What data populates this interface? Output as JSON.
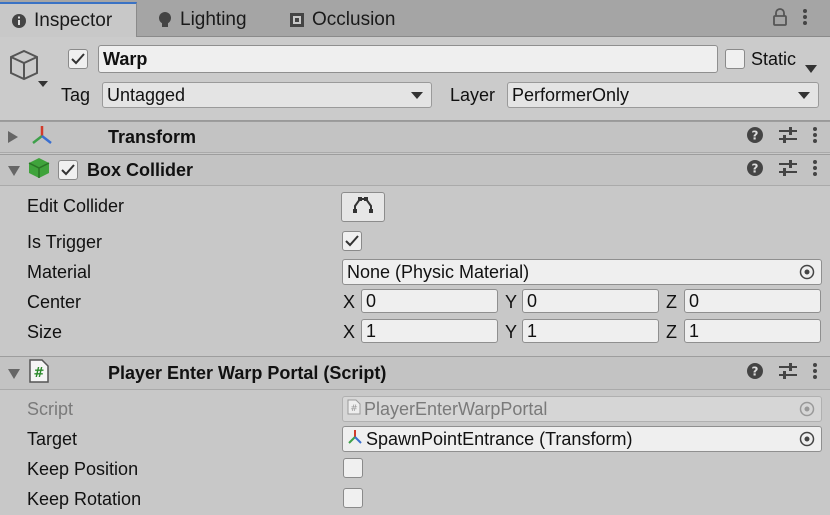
{
  "tabs": [
    {
      "label": "Inspector",
      "active": true
    },
    {
      "label": "Lighting",
      "active": false
    },
    {
      "label": "Occlusion",
      "active": false
    }
  ],
  "object": {
    "active_checked": true,
    "name": "Warp",
    "static_label": "Static",
    "static_checked": false,
    "tag_label": "Tag",
    "tag_value": "Untagged",
    "layer_label": "Layer",
    "layer_value": "PerformerOnly"
  },
  "transform": {
    "title": "Transform",
    "expanded": false
  },
  "box_collider": {
    "title": "Box Collider",
    "enabled": true,
    "expanded": true,
    "edit_collider_label": "Edit Collider",
    "is_trigger_label": "Is Trigger",
    "is_trigger_checked": true,
    "material_label": "Material",
    "material_value": "None (Physic Material)",
    "center_label": "Center",
    "center": {
      "x": "0",
      "y": "0",
      "z": "0"
    },
    "size_label": "Size",
    "size": {
      "x": "1",
      "y": "1",
      "z": "1"
    },
    "axis": {
      "x": "X",
      "y": "Y",
      "z": "Z"
    }
  },
  "script_comp": {
    "title": "Player Enter Warp Portal (Script)",
    "expanded": true,
    "script_label": "Script",
    "script_value": "PlayerEnterWarpPortal",
    "target_label": "Target",
    "target_value": "SpawnPointEntrance (Transform)",
    "keep_position_label": "Keep Position",
    "keep_position_checked": false,
    "keep_rotation_label": "Keep Rotation",
    "keep_rotation_checked": false
  },
  "colors": {
    "tab_accent": "#3a72c4",
    "collider_icon": "#3fa33b",
    "transform_red": "#d23a2a",
    "transform_green": "#3ea04a",
    "transform_blue": "#3a6fd0"
  }
}
